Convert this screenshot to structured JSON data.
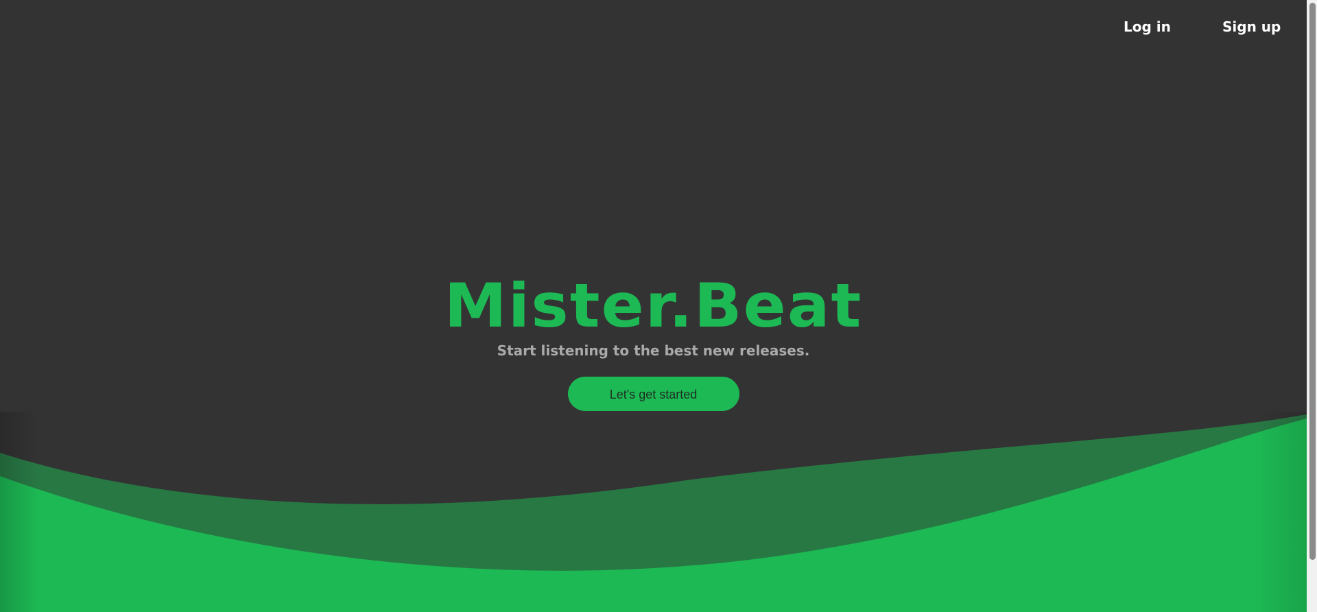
{
  "nav": {
    "login_label": "Log in",
    "signup_label": "Sign up"
  },
  "hero": {
    "brand": "Mister.Beat",
    "tagline": "Start listening to the best new releases.",
    "cta_label": "Let's get started"
  },
  "colors": {
    "background": "#333333",
    "accent": "#1db954",
    "wave_dark": "#287844",
    "tagline": "#aaaaaa"
  }
}
